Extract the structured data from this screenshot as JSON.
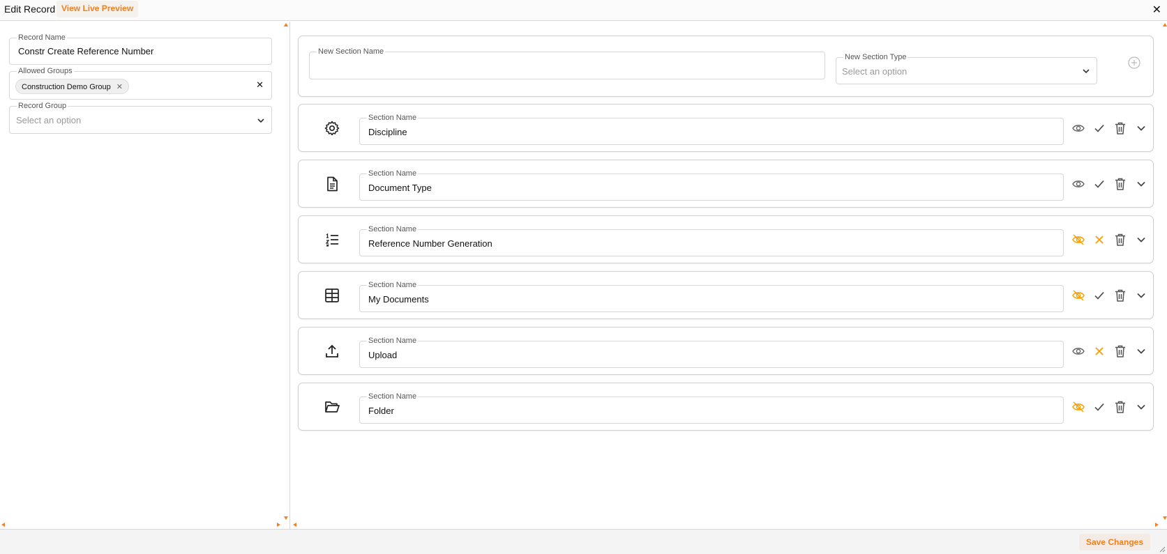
{
  "header": {
    "title": "Edit Record",
    "preview_label": "View Live Preview",
    "close_glyph": "✕"
  },
  "left_panel": {
    "record_name": {
      "label": "Record Name",
      "value": "Constr Create Reference Number"
    },
    "allowed_groups": {
      "label": "Allowed Groups",
      "chips": [
        "Construction Demo Group"
      ],
      "clear_glyph": "✕"
    },
    "record_group": {
      "label": "Record Group",
      "placeholder": "Select an option"
    }
  },
  "new_section": {
    "name_label": "New Section Name",
    "name_value": "",
    "type_label": "New Section Type",
    "type_placeholder": "Select an option",
    "add_icon": "plus-circle-icon"
  },
  "sections": [
    {
      "icon": "gear-icon",
      "label": "Section Name",
      "value": "Discipline",
      "visible": true,
      "enabled": true
    },
    {
      "icon": "document-icon",
      "label": "Section Name",
      "value": "Document Type",
      "visible": true,
      "enabled": true
    },
    {
      "icon": "numbered-list-icon",
      "label": "Section Name",
      "value": "Reference Number Generation",
      "visible": false,
      "enabled": false
    },
    {
      "icon": "table-icon",
      "label": "Section Name",
      "value": "My Documents",
      "visible": false,
      "enabled": true
    },
    {
      "icon": "upload-icon",
      "label": "Section Name",
      "value": "Upload",
      "visible": true,
      "enabled": false
    },
    {
      "icon": "folder-icon",
      "label": "Section Name",
      "value": "Folder",
      "visible": false,
      "enabled": true
    }
  ],
  "footer": {
    "save_label": "Save Changes"
  },
  "colors": {
    "accent": "#f08020",
    "warning": "#f5a000",
    "icon_gray": "#555555"
  }
}
